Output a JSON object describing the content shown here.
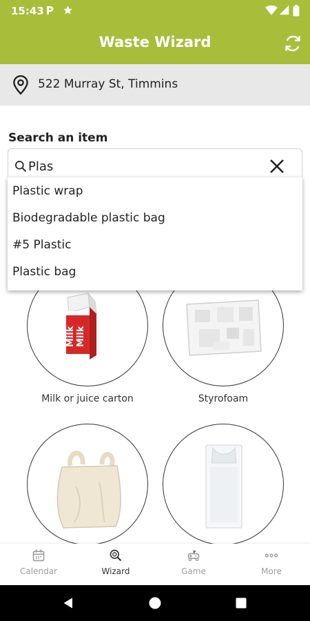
{
  "status_bar": {
    "time": "15:43",
    "icons": [
      "parking-icon",
      "star-icon",
      "wifi-icon",
      "signal-icon",
      "battery-icon"
    ]
  },
  "app_bar": {
    "title": "Waste Wizard",
    "refresh_icon": "refresh-icon"
  },
  "location": {
    "address": "522 Murray St, Timmins",
    "icon": "location-pin-icon"
  },
  "search": {
    "label": "Search an item",
    "value": "Plas",
    "suggestions": [
      "Plastic wrap",
      "Biodegradable plastic bag",
      "#5 Plastic",
      "Plastic bag"
    ]
  },
  "items": [
    {
      "label": "Milk or juice carton"
    },
    {
      "label": "Styrofoam"
    },
    {
      "label": ""
    },
    {
      "label": ""
    }
  ],
  "bottom_nav": [
    {
      "label": "Calendar",
      "icon": "calendar-icon"
    },
    {
      "label": "Wizard",
      "icon": "wizard-search-icon"
    },
    {
      "label": "Game",
      "icon": "game-icon"
    },
    {
      "label": "More",
      "icon": "more-icon"
    }
  ],
  "colors": {
    "primary": "#a8bd3a",
    "address_bg": "#e8e8e8",
    "nav_inactive": "#9e9e9e"
  },
  "milk_carton_text": "Milk"
}
